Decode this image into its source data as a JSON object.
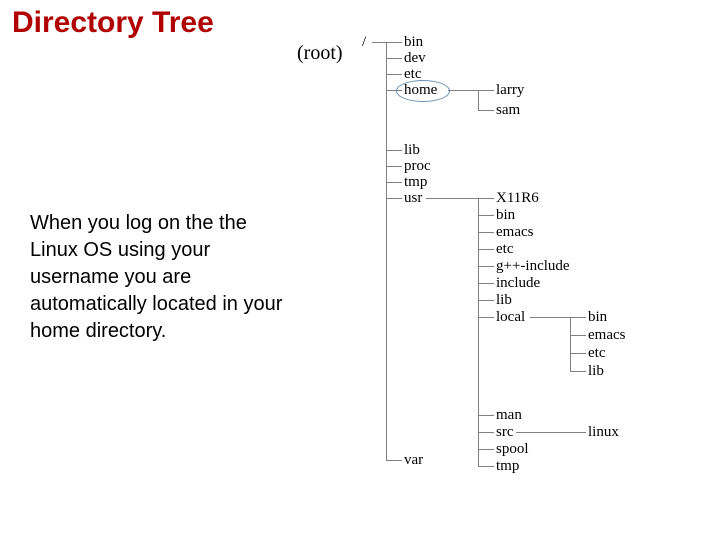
{
  "title": "Directory Tree",
  "root_label": "(root)",
  "paragraph": "When you log on the the Linux OS using your username you are automatically located in your home directory.",
  "tree": {
    "root": "/",
    "level1": {
      "bin": "bin",
      "dev": "dev",
      "etc": "etc",
      "home": "home",
      "lib": "lib",
      "proc": "proc",
      "tmp": "tmp",
      "usr": "usr",
      "var": "var"
    },
    "home_children": {
      "larry": "larry",
      "sam": "sam"
    },
    "usr_children": {
      "X11R6": "X11R6",
      "bin": "bin",
      "emacs": "emacs",
      "etc": "etc",
      "gpp": "g++-include",
      "include": "include",
      "lib": "lib",
      "local": "local",
      "man": "man",
      "src": "src",
      "spool": "spool",
      "tmp": "tmp"
    },
    "local_children": {
      "bin": "bin",
      "emacs": "emacs",
      "etc": "etc",
      "lib": "lib"
    },
    "var_child": {
      "linux": "linux"
    }
  }
}
